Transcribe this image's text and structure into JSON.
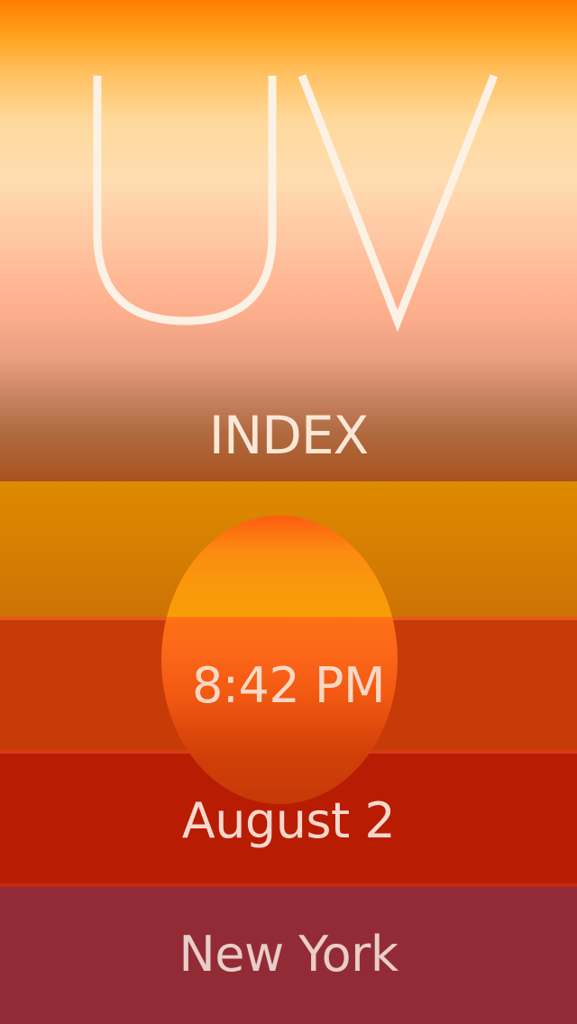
{
  "hero": {
    "title": "UV",
    "subtitle": "INDEX"
  },
  "sunset": {
    "time": "8:42 PM",
    "date": "August 2",
    "city": "New York"
  },
  "colors": {
    "hero_top": "#ff7e00",
    "hero_mid": "#ffdcb0",
    "hero_bottom": "#a85320",
    "sunset_band": "#d88000",
    "time_band": "#c63b08",
    "date_band": "#b81c02",
    "city_band": "#932b37",
    "text_light": "#fbf1e4"
  }
}
